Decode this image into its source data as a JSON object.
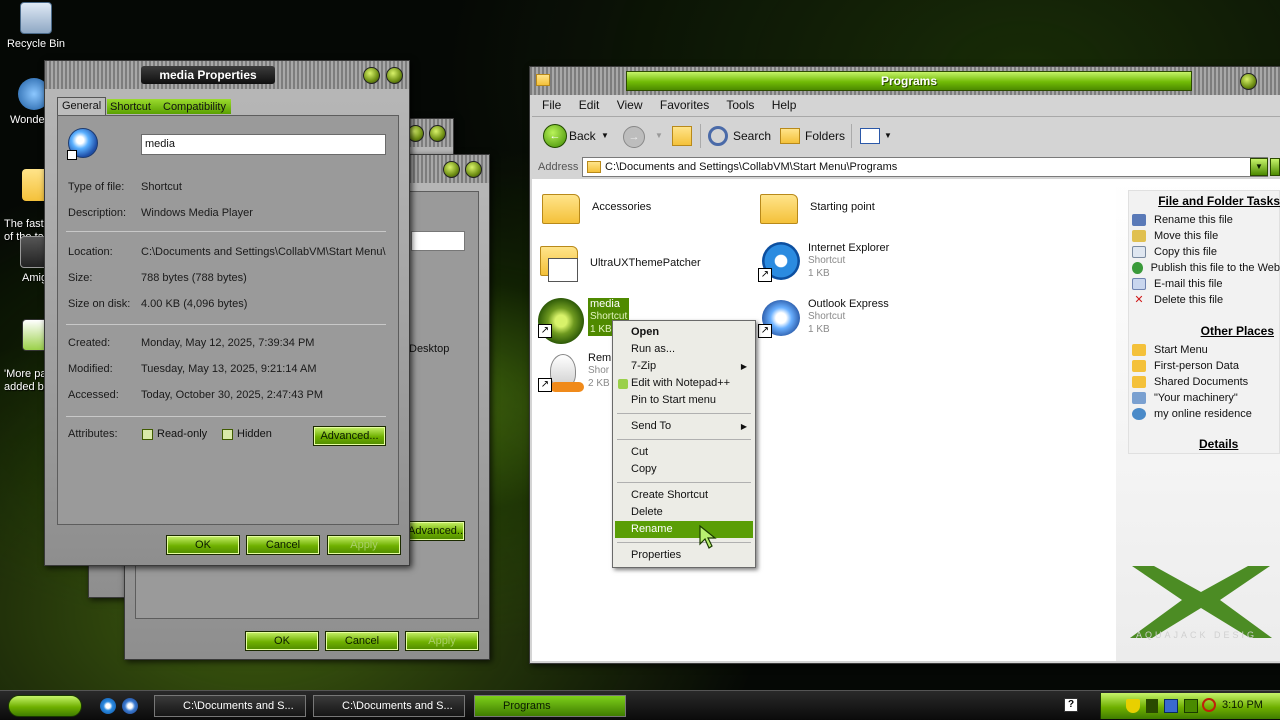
{
  "desktop": {
    "icons": [
      {
        "label": "Recycle Bin"
      },
      {
        "label": "Wonde"
      },
      {
        "label": "The fast\nof the ta"
      },
      {
        "label": "Amig"
      },
      {
        "label": "'More pa\nadded b"
      }
    ],
    "bg_dialog_text": "Desktop",
    "bg_dialog_buttons": {
      "ok": "OK",
      "cancel": "Cancel",
      "apply": "Apply",
      "advanced": "Advanced..."
    }
  },
  "properties": {
    "title": "media Properties",
    "tabs": [
      "General",
      "Shortcut",
      "Compatibility"
    ],
    "name_value": "media",
    "rows": {
      "type_label": "Type of file:",
      "type_value": "Shortcut",
      "desc_label": "Description:",
      "desc_value": "Windows Media Player",
      "location_label": "Location:",
      "location_value": "C:\\Documents and Settings\\CollabVM\\Start Menu\\",
      "size_label": "Size:",
      "size_value": "788 bytes (788 bytes)",
      "disk_label": "Size on disk:",
      "disk_value": "4.00 KB (4,096 bytes)",
      "created_label": "Created:",
      "created_value": "Monday, May 12, 2025, 7:39:34 PM",
      "modified_label": "Modified:",
      "modified_value": "Tuesday, May 13, 2025, 9:21:14 AM",
      "accessed_label": "Accessed:",
      "accessed_value": "Today, October 30, 2025, 2:47:43 PM",
      "attributes_label": "Attributes:"
    },
    "readonly_label": "Read-only",
    "hidden_label": "Hidden",
    "advanced_label": "Advanced...",
    "ok_label": "OK",
    "cancel_label": "Cancel",
    "apply_label": "Apply"
  },
  "explorer": {
    "title": "Programs",
    "menu": [
      "File",
      "Edit",
      "View",
      "Favorites",
      "Tools",
      "Help"
    ],
    "toolbar": {
      "back": "Back",
      "search": "Search",
      "folders": "Folders"
    },
    "address_label": "Address",
    "address_value": "C:\\Documents and Settings\\CollabVM\\Start Menu\\Programs",
    "sidebar": {
      "file_tasks_title": "File and Folder Tasks",
      "file_tasks": [
        "Rename this file",
        "Move this file",
        "Copy this file",
        "Publish this file to the Web",
        "E-mail this file",
        "Delete this file"
      ],
      "other_places_title": "Other Places",
      "other_places": [
        "Start Menu",
        "First-person Data",
        "Shared Documents",
        "\"Your machinery\"",
        "my online residence"
      ],
      "details_title": "Details"
    },
    "files": {
      "accessories": {
        "name": "Accessories"
      },
      "starting_point": {
        "name": "Starting point"
      },
      "ultrux": {
        "name": "UltraUXThemePatcher"
      },
      "ie": {
        "name": "Internet Explorer",
        "type": "Shortcut",
        "size": "1 KB"
      },
      "media": {
        "name": "media",
        "type": "Shortcut",
        "size": "1 KB"
      },
      "outlook": {
        "name": "Outlook Express",
        "type": "Shortcut",
        "size": "1 KB"
      },
      "remote": {
        "name": "Rem",
        "type": "Shor",
        "size": "2 KB"
      }
    },
    "watermark": "AQUAJACK DESIG"
  },
  "context_menu": {
    "items": [
      "Open",
      "Run as...",
      "7-Zip",
      "Edit with Notepad++",
      "Pin to Start menu",
      "Send To",
      "Cut",
      "Copy",
      "Create Shortcut",
      "Delete",
      "Rename",
      "Properties"
    ]
  },
  "taskbar": {
    "buttons": [
      "C:\\Documents and S...",
      "C:\\Documents and S...",
      "Programs"
    ],
    "clock": "3:10 PM"
  },
  "colors": {
    "accent": "#5a9e06",
    "title_green": "#7cc000"
  }
}
